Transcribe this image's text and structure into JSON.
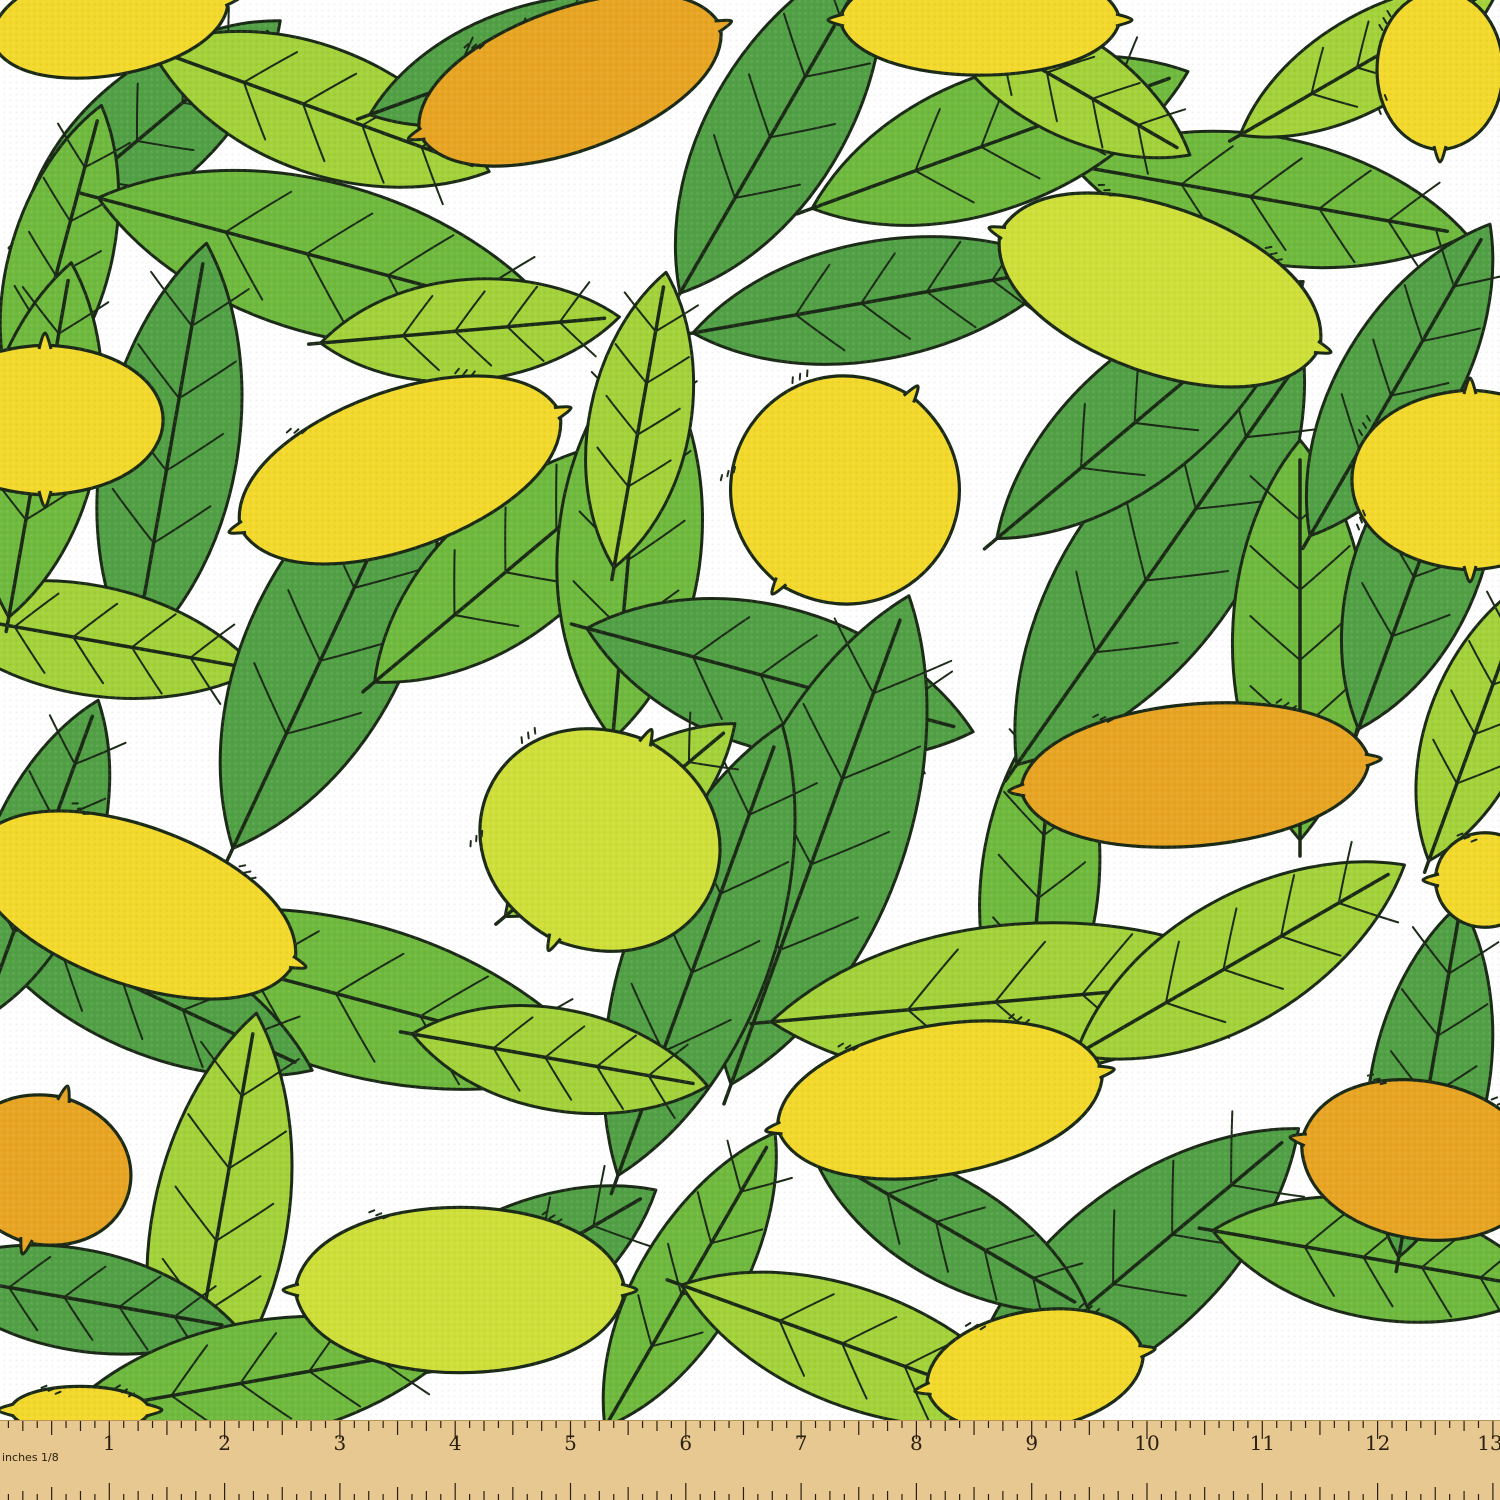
{
  "image": {
    "subject": "lemon-and-leaf-pattern-fabric",
    "colors": {
      "background": "#ffffff",
      "leaf_dark": "#52a046",
      "leaf_mid": "#6fba3e",
      "leaf_light": "#a3d23a",
      "lemon_yellow": "#f3d92c",
      "lemon_lime": "#cfdf3a",
      "lemon_orange": "#e8a523",
      "outline": "#1b2a16",
      "ruler_wood": "#e6c890",
      "ruler_ink": "#2b2010"
    }
  },
  "ruler": {
    "unit_label": "inches 1/8",
    "numbers": [
      "1",
      "2",
      "3",
      "4",
      "5",
      "6",
      "7",
      "8",
      "9",
      "10",
      "11",
      "12",
      "13"
    ]
  }
}
